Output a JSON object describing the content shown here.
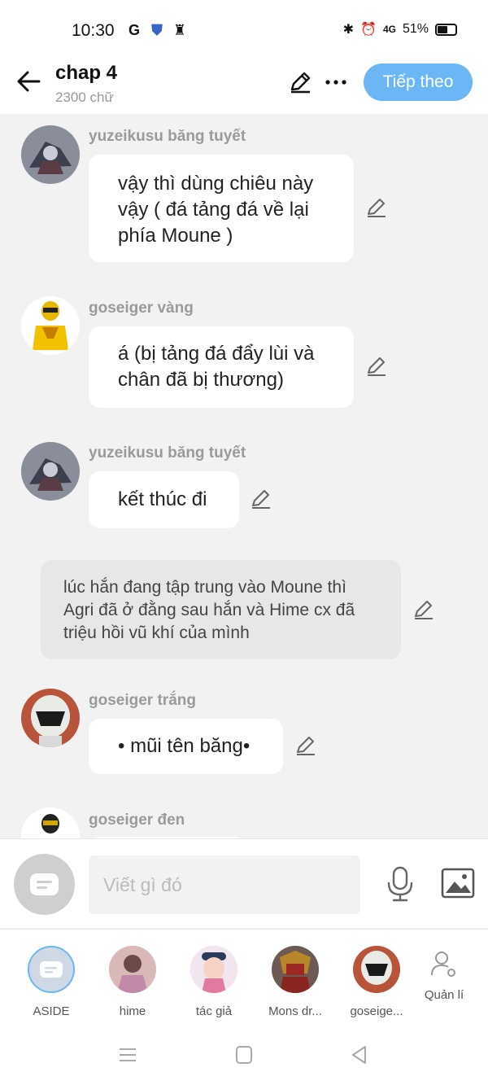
{
  "status_bar": {
    "time": "10:30",
    "network": "4G",
    "battery": "51%"
  },
  "header": {
    "title": "chap 4",
    "subtitle": "2300 chữ",
    "next_label": "Tiếp theo"
  },
  "messages": [
    {
      "speaker": "yuzeikusu băng tuyết",
      "text": "vậy thì dùng chiêu này vậy ( đá tảng đá về lại phía Moune )"
    },
    {
      "speaker": "goseiger vàng",
      "text": "á (bị tảng đá đẩy lùi và chân đã bị thương)"
    },
    {
      "speaker": "yuzeikusu băng tuyết",
      "text": "kết thúc đi"
    },
    {
      "speaker": "",
      "text": "lúc hắn đang tập trung vào Moune thì Agri đã ở đằng sau hắn và Hime cx đã triệu hồi vũ khí của mình"
    },
    {
      "speaker": "goseiger trắng",
      "text": "• mũi tên băng•"
    },
    {
      "speaker": "goseiger đen",
      "text": ""
    }
  ],
  "composer": {
    "placeholder": "Viết gì đó"
  },
  "characters": [
    {
      "label": "ASIDE"
    },
    {
      "label": "hime"
    },
    {
      "label": "tác giả"
    },
    {
      "label": "Mons dr..."
    },
    {
      "label": "goseige..."
    }
  ],
  "manage_label": "Quản lí",
  "colors": {
    "accent": "#6bb7f5",
    "name_gray": "#9a9a9a",
    "narration_bg": "#e7e7e7"
  }
}
